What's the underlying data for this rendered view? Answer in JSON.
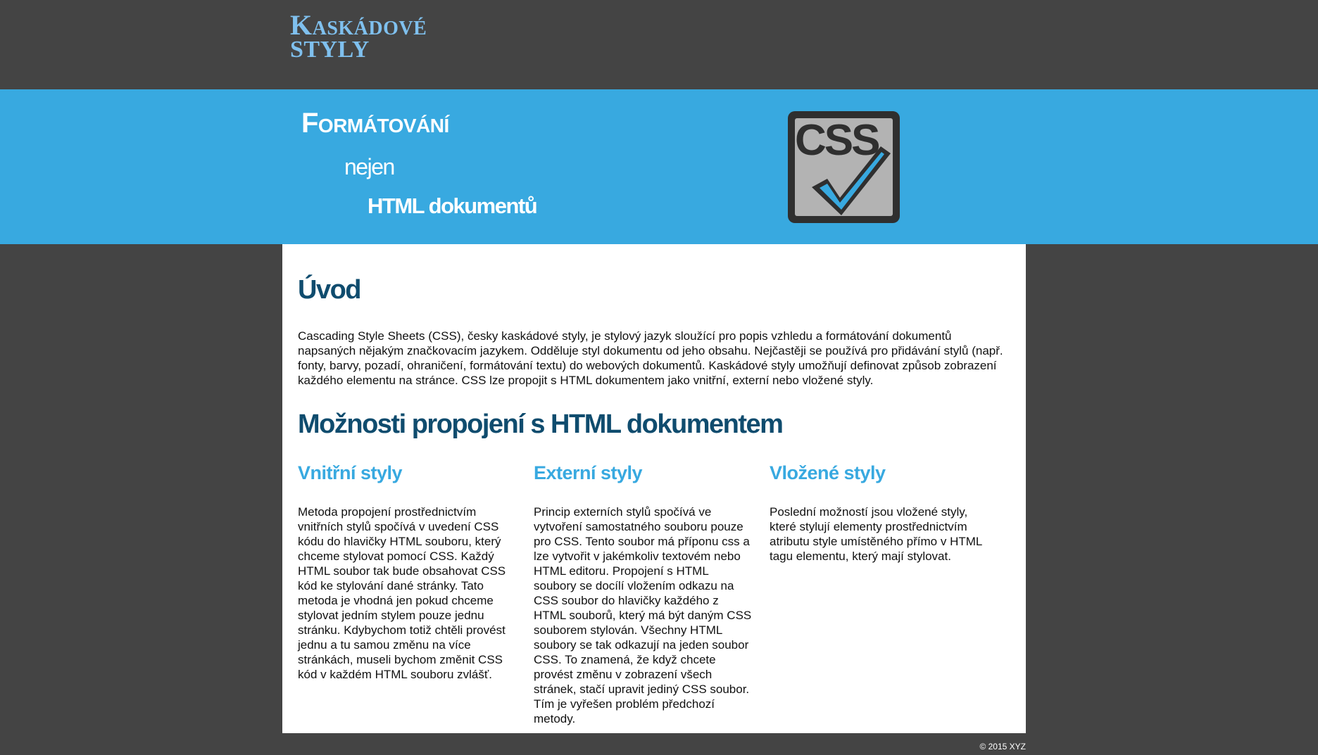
{
  "header": {
    "logo_line1": "Kaskádové",
    "logo_line2": "STYLY"
  },
  "banner": {
    "line1": "Formátování",
    "line2": "nejen",
    "line3": "HTML dokumentů",
    "logo_text": "CSS",
    "logo_icon": "css-checkmark-icon"
  },
  "main": {
    "intro_heading": "Úvod",
    "intro_text": "Cascading Style Sheets (CSS), česky kaskádové styly, je stylový jazyk sloužící pro popis vzhledu a formátování dokumentů napsaných nějakým značkovacím jazykem. Odděluje styl dokumentu od jeho obsahu. Nejčastěji se používá pro přidávání stylů (např. fonty, barvy, pozadí, ohraničení, formátování textu) do webových dokumentů. Kaskádové styly umožňují definovat způsob zobrazení každého elementu na stránce. CSS lze propojit s HTML dokumentem jako vnitřní, externí nebo vložené styly.",
    "options_heading": "Možnosti propojení s HTML dokumentem",
    "columns": [
      {
        "title": "Vnitřní styly",
        "text": "Metoda propojení prostřednictvím vnitřních stylů spočívá v uvedení CSS kódu do hlavičky HTML souboru, který chceme stylovat pomocí CSS. Každý HTML soubor tak bude obsahovat CSS kód ke stylování dané stránky. Tato metoda je vhodná jen pokud chceme stylovat jedním stylem pouze jednu stránku. Kdybychom totiž chtěli provést jednu a tu samou změnu na více stránkách, museli bychom změnit CSS kód v každém HTML souboru zvlášť."
      },
      {
        "title": "Externí styly",
        "text": "Princip externích stylů spočívá ve vytvoření samostatného souboru pouze pro CSS. Tento soubor má příponu css a lze vytvořit v jakémkoliv textovém nebo HTML editoru. Propojení s HTML soubory se docílí vložením odkazu na CSS soubor do hlavičky každého z HTML souborů, který má být daným CSS souborem stylován. Všechny HTML soubory se tak odkazují na jeden soubor CSS. To znamená, že když chcete provést změnu v zobrazení všech stránek, stačí upravit jediný CSS soubor. Tím je vyřešen problém předchozí metody."
      },
      {
        "title": "Vložené styly",
        "text": "Poslední možností jsou vložené styly, které stylují elementy prostřednictvím atributu style umístěného přímo v HTML tagu elementu, který mají stylovat."
      }
    ]
  },
  "footer": {
    "copyright": "© 2015 XYZ"
  },
  "colors": {
    "page_bg": "#444444",
    "banner_bg": "#38a9e0",
    "logo_text": "#7fc0ee",
    "heading": "#0f4c6e",
    "subheading": "#38a9e0"
  }
}
